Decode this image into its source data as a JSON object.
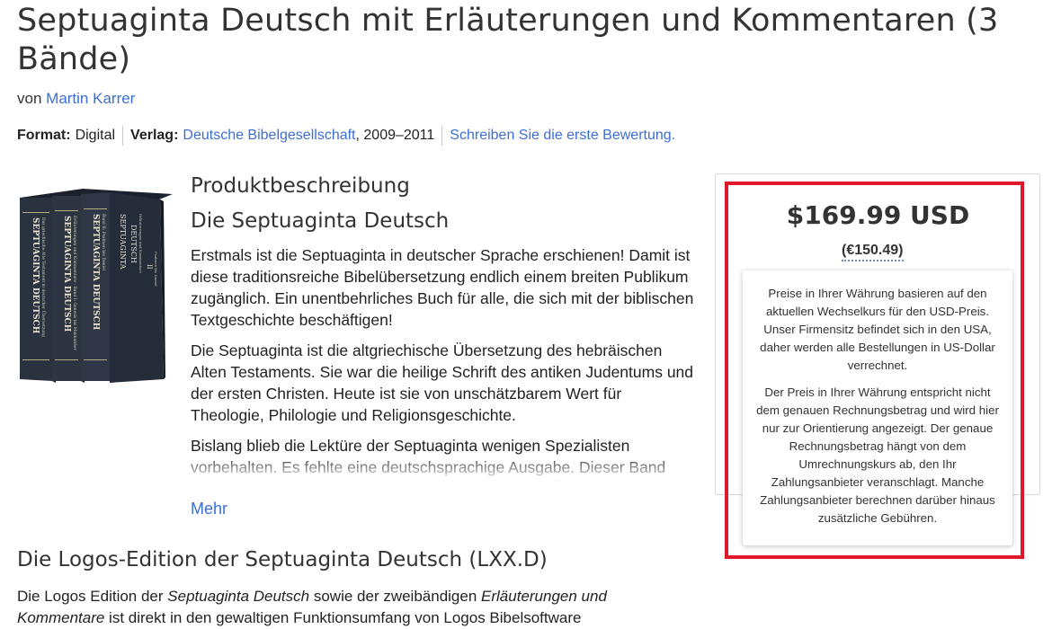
{
  "product": {
    "title": "Septuaginta Deutsch mit Erläuterungen und Kommentaren (3 Bände)",
    "by_prefix": "von",
    "author": "Martin Karrer",
    "format_label": "Format:",
    "format_value": "Digital",
    "publisher_label": "Verlag:",
    "publisher": "Deutsche Bibelgesellschaft",
    "years": ", 2009–2011",
    "review_link": "Schreiben Sie die erste Bewertung."
  },
  "cover": {
    "spine_title": "SEPTUAGINTA DEUTSCH",
    "spine1_sub": "Das griechische Alte Testament in deutscher Übersetzung",
    "spine2_sub": "Erläuterungen und Kommentare · Band I: Genesis bis Makkabäer",
    "spine3_sub": "Band II: Psalmen bis Daniel",
    "front_title_1": "SEPTUAGINTA",
    "front_title_2": "DEUTSCH",
    "front_sub": "Erläuterungen und Kommentare",
    "front_vol": "II",
    "front_vol_sub": "Psalmen bis Daniel"
  },
  "description": {
    "heading": "Produktbeschreibung",
    "subheading": "Die Septuaginta Deutsch",
    "p1": "Erstmals ist die Septuaginta in deutscher Sprache erschienen! Damit ist diese traditionsreiche Bibelübersetzung endlich einem breiten Publikum zugänglich. Ein unentbehrliches Buch für alle, die sich mit der biblischen Textgeschichte beschäftigen!",
    "p2": "Die Septuaginta ist die altgriechische Übersetzung des hebräischen Alten Testaments. Sie war die heilige Schrift des antiken Judentums und der ersten Christen. Heute ist sie von unschätzbarem Wert für Theologie, Philologie und Religionsgeschichte.",
    "p3": "Bislang blieb die Lektüre der Septuaginta wenigen Spezialisten vorbehalten. Es fehlte eine deutschsprachige Ausgabe. Dieser Band enthält die erste vollständige deutsche Septuaginta-Übersetzung",
    "more": "Mehr"
  },
  "edition": {
    "heading": "Die Logos-Edition der Septuaginta Deutsch (LXX.D)",
    "text_1": "Die Logos Edition der ",
    "text_em1": "Septuaginta Deutsch",
    "text_2": " sowie der zweibändigen ",
    "text_em2": "Erläuterungen und Kommentare",
    "text_3": " ist direkt in den gewaltigen Funktionsumfang von Logos Bibelsoftware"
  },
  "pricing": {
    "price": "$169.99 USD",
    "converted": "(€150.49)",
    "tooltip_p1": "Preise in Ihrer Währung basieren auf den aktuellen Wechselkurs für den USD-Preis. Unser Firmensitz befindet sich in den USA, daher werden alle Bestellungen in US-Dollar verrechnet.",
    "tooltip_p2": "Der Preis in Ihrer Währung entspricht nicht dem genauen Rechnungsbetrag und wird hier nur zur Orientierung angezeigt. Der genaue Rechnungsbetrag hängt von dem Umrechnungskurs ab, den Ihr Zahlungsanbieter veranschlagt. Manche Zahlungsanbieter berechnen darüber hinaus zusätzliche Gebühren."
  },
  "colors": {
    "link": "#3d6fd1",
    "highlight": "#e0182d",
    "book_cover": "#2c3443",
    "book_text": "#e9e3d0"
  }
}
